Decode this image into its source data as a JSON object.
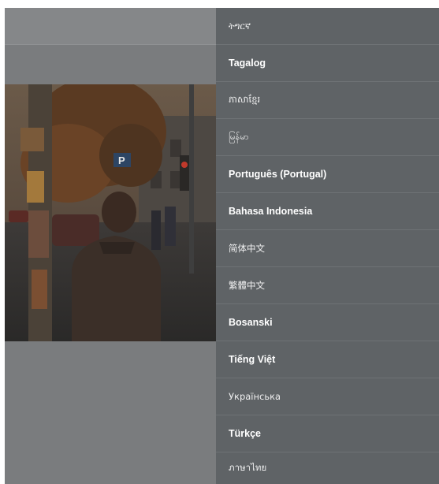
{
  "language_menu": {
    "items": [
      {
        "label": "ትግርኛ",
        "style": "light"
      },
      {
        "label": "Tagalog",
        "style": "bold"
      },
      {
        "label": "ភាសាខ្មែរ",
        "style": "light"
      },
      {
        "label": "မြန်မာ",
        "style": "light"
      },
      {
        "label": "Português (Portugal)",
        "style": "bold"
      },
      {
        "label": "Bahasa Indonesia",
        "style": "bold"
      },
      {
        "label": "简体中文",
        "style": "light"
      },
      {
        "label": "繁體中文",
        "style": "light"
      },
      {
        "label": "Bosanski",
        "style": "bold"
      },
      {
        "label": "Tiếng Việt",
        "style": "bold"
      },
      {
        "label": "Українська",
        "style": "light"
      },
      {
        "label": "Türkçe",
        "style": "bold"
      },
      {
        "label": "ภาษาไทย",
        "style": "light"
      }
    ]
  },
  "colors": {
    "overlay": "#7a7c7e",
    "menu_background": "#5f6366",
    "menu_text": "#ffffff"
  }
}
